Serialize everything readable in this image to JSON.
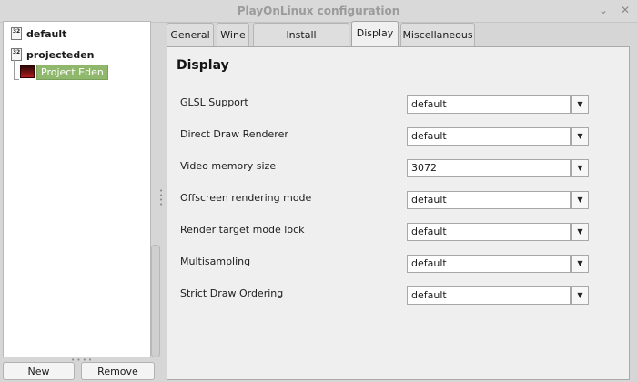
{
  "window": {
    "title": "PlayOnLinux configuration",
    "minimize_glyph": "⌄",
    "close_glyph": "✕"
  },
  "sidebar": {
    "prefixes": [
      {
        "label": "default",
        "icon": "wineprefix-icon",
        "icon_text": "32"
      },
      {
        "label": "projecteden",
        "icon": "wineprefix-icon",
        "icon_text": "32"
      }
    ],
    "app": {
      "label": "Project Eden",
      "icon": "project-eden-icon"
    },
    "buttons": {
      "new": "New",
      "remove": "Remove"
    }
  },
  "tabs": [
    {
      "label": "General",
      "active": false
    },
    {
      "label": "Wine",
      "active": false
    },
    {
      "label": "Install components",
      "active": false
    },
    {
      "label": "Display",
      "active": true
    },
    {
      "label": "Miscellaneous",
      "active": false
    }
  ],
  "panel": {
    "heading": "Display",
    "settings": [
      {
        "label": "GLSL Support",
        "value": "default"
      },
      {
        "label": "Direct Draw Renderer",
        "value": "default"
      },
      {
        "label": "Video memory size",
        "value": "3072"
      },
      {
        "label": "Offscreen rendering mode",
        "value": "default"
      },
      {
        "label": "Render target mode lock",
        "value": "default"
      },
      {
        "label": "Multisampling",
        "value": "default"
      },
      {
        "label": "Strict Draw Ordering",
        "value": "default"
      }
    ]
  },
  "colors": {
    "selection": "#8fb86d",
    "background": "#d6d6d6"
  }
}
